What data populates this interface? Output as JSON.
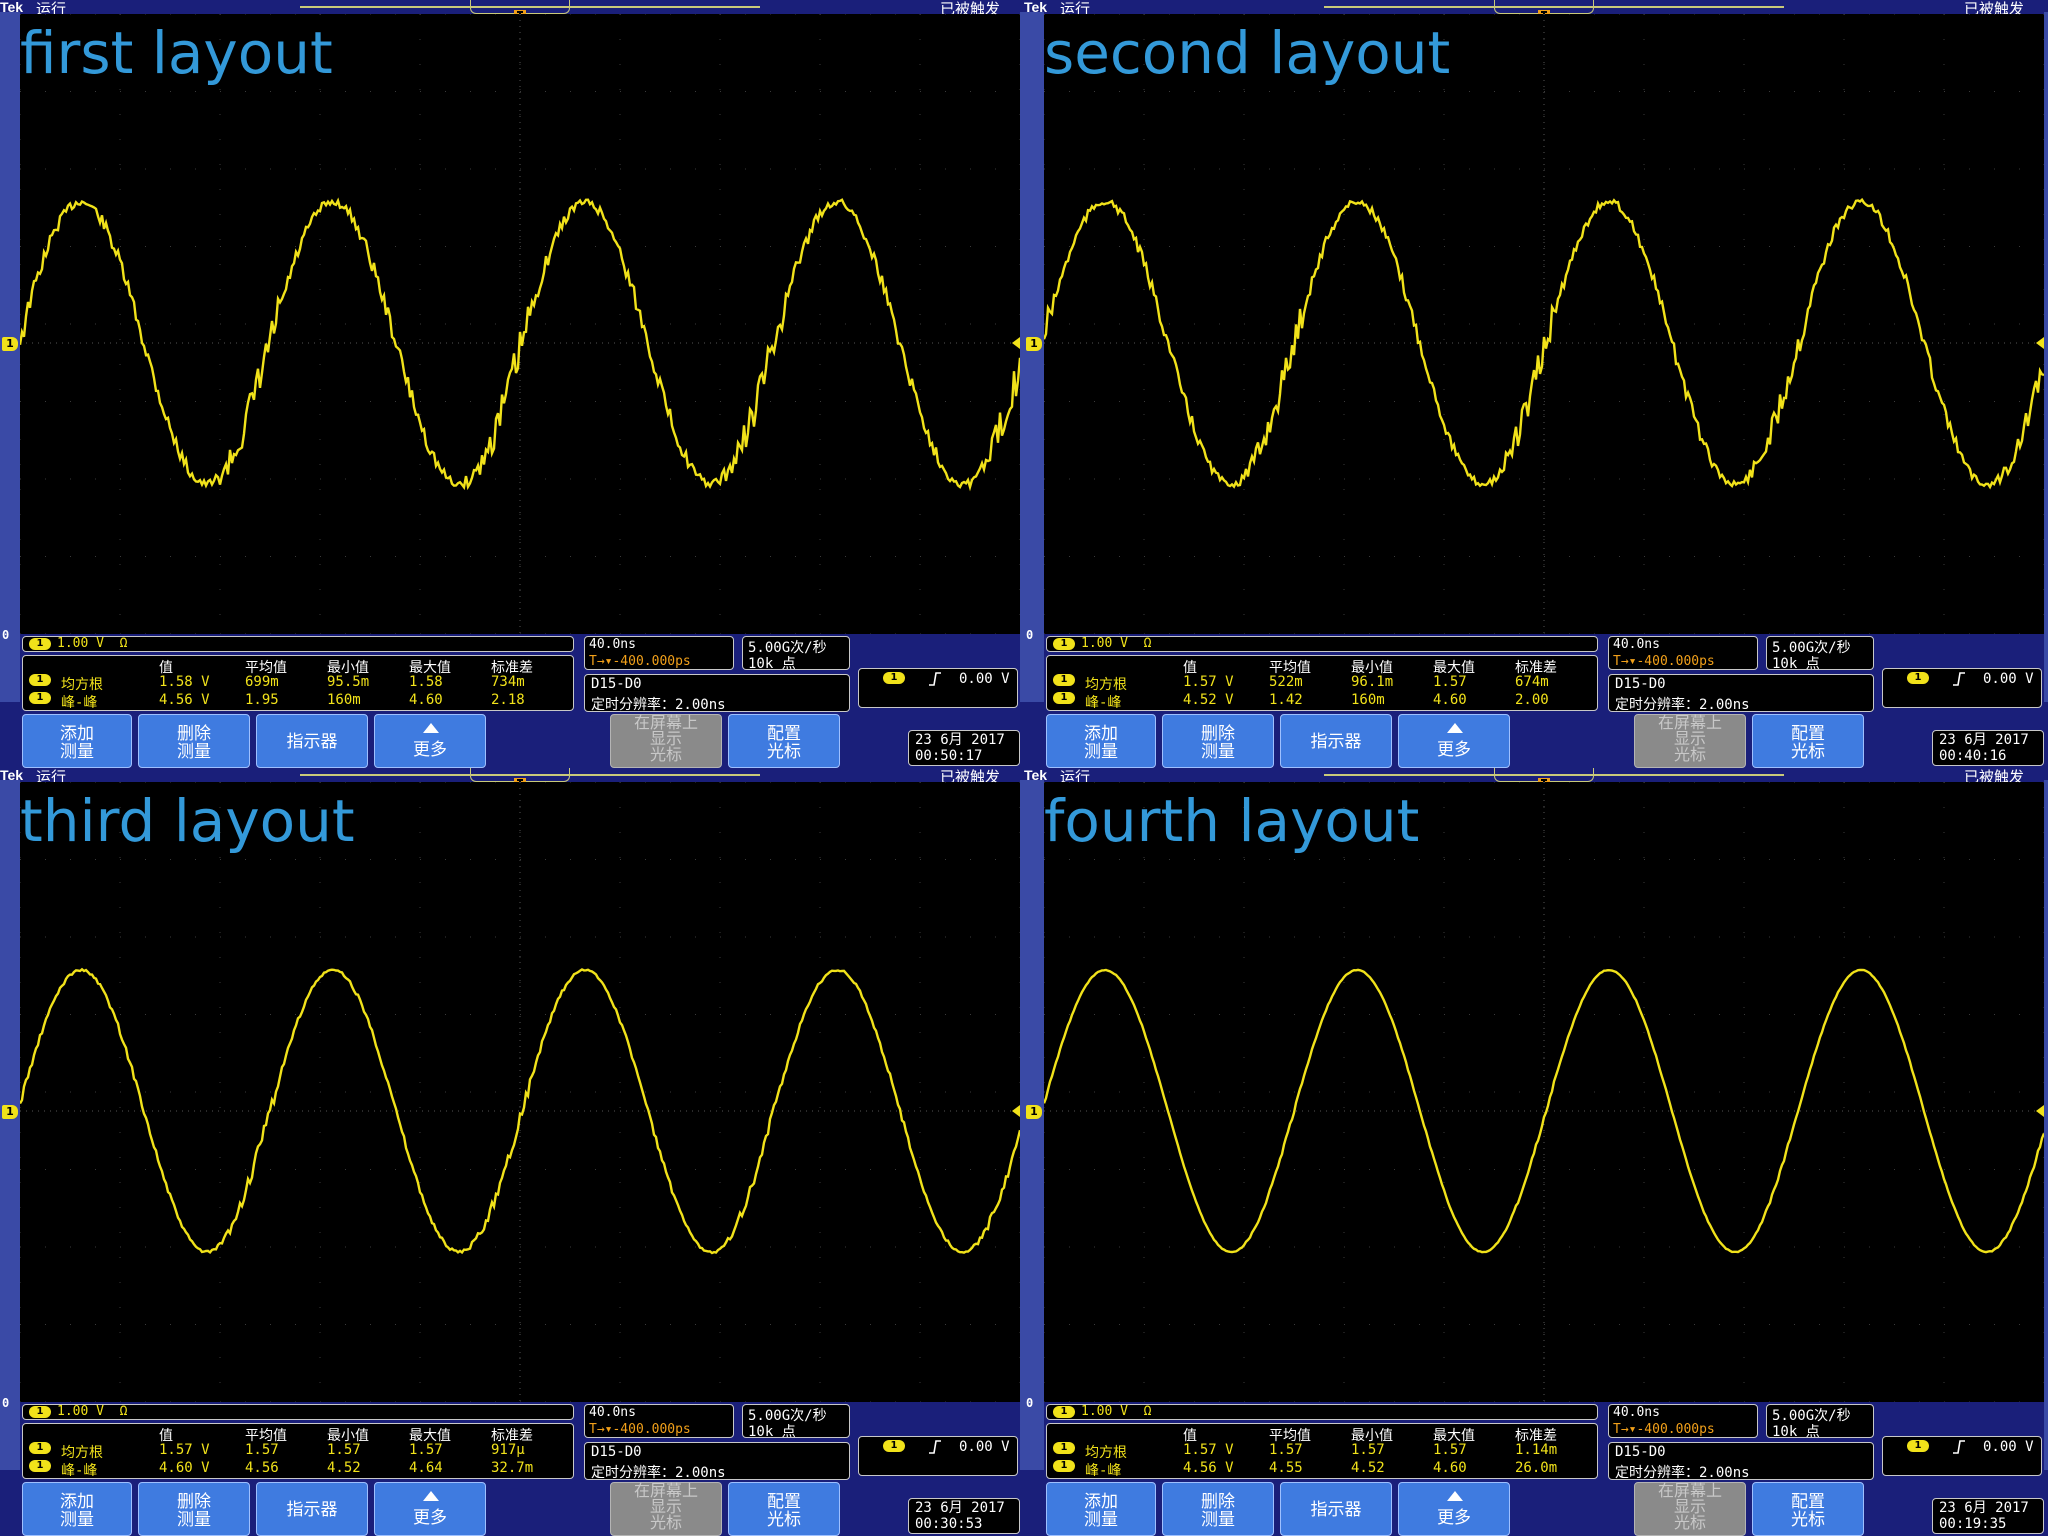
{
  "colors": {
    "trace": "#f1e21a",
    "title": "#3399d9",
    "frame": "#1a1f7a",
    "softkey": "#3f7be0"
  },
  "common": {
    "brand": "Tek",
    "run_state": "运行",
    "trigger_state": "已被触发",
    "channel_marker": "1",
    "ground_marker": "0",
    "ch_badge": "1",
    "ch_scale": "1.00 V",
    "ch_impedance": "Ω",
    "meas_headers": [
      "值",
      "平均值",
      "最小值",
      "最大值",
      "标准差"
    ],
    "meas_row1_label": "均方根",
    "meas_row2_label": "峰-峰",
    "timebase": "40.0ns",
    "trigger_position": "T→▾-400.000ps",
    "sample_rate": "5.00G次/秒",
    "record_length": "10k 点",
    "digital_channels": "D15-D0",
    "timing_resolution": "定时分辨率：2.00ns",
    "trigger_level": "0.00 V",
    "softkeys": {
      "add_measurement": "添加\n测量",
      "delete_measurement": "删除\n测量",
      "indicator": "指示器",
      "more": "更多",
      "show_cursors": "在屏幕上\n显示\n光标",
      "config_cursors": "配置\n光标"
    }
  },
  "screens": [
    {
      "title": "first layout",
      "rms": [
        "1.58 V",
        "699m",
        "95.5m",
        "1.58",
        "734m"
      ],
      "pkpk": [
        "4.56 V",
        "1.95",
        "160m",
        "4.60",
        "2.18"
      ],
      "date": "23 6月  2017",
      "time": "00:50:17",
      "noise": 3
    },
    {
      "title": "second layout",
      "rms": [
        "1.57 V",
        "522m",
        "96.1m",
        "1.57",
        "674m"
      ],
      "pkpk": [
        "4.52 V",
        "1.42",
        "160m",
        "4.60",
        "2.00"
      ],
      "date": "23 6月  2017",
      "time": "00:40:16",
      "noise": 2.5
    },
    {
      "title": "third layout",
      "rms": [
        "1.57 V",
        "1.57",
        "1.57",
        "1.57",
        "917μ"
      ],
      "pkpk": [
        "4.60 V",
        "4.56",
        "4.52",
        "4.64",
        "32.7m"
      ],
      "date": "23 6月  2017",
      "time": "00:30:53",
      "noise": 1
    },
    {
      "title": "fourth layout",
      "rms": [
        "1.57 V",
        "1.57",
        "1.57",
        "1.57",
        "1.14m"
      ],
      "pkpk": [
        "4.56 V",
        "4.55",
        "4.52",
        "4.60",
        "26.0m"
      ],
      "date": "23 6月  2017",
      "time": "00:19:35",
      "noise": 0.3
    }
  ]
}
